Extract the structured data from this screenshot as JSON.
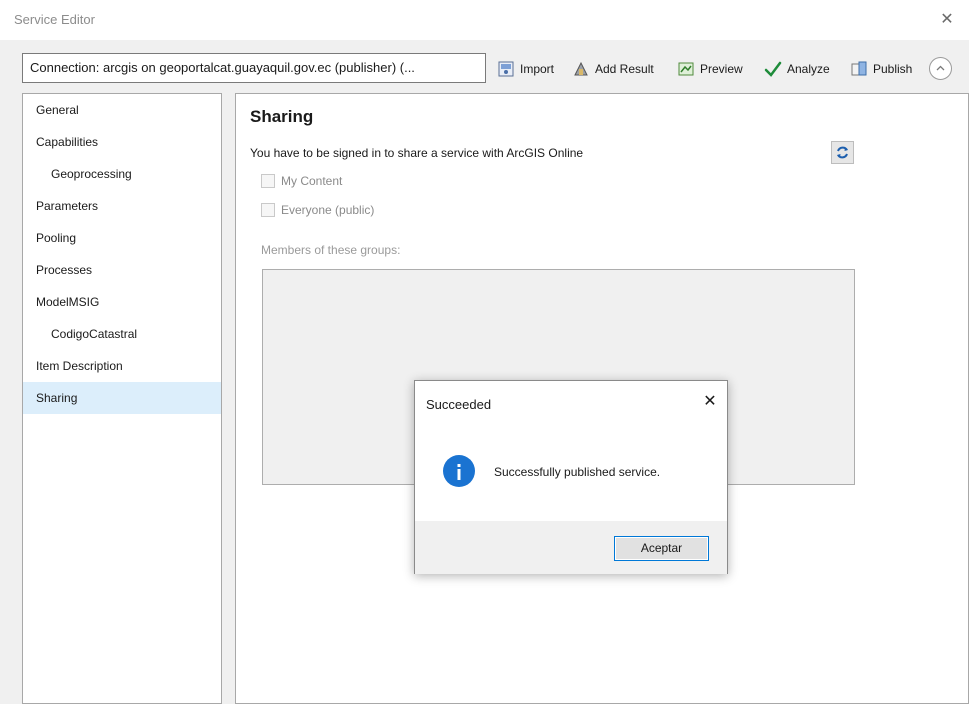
{
  "window": {
    "title": "Service Editor",
    "close_glyph": "✕"
  },
  "toolbar": {
    "connection_text": "Connection: arcgis on geoportalcat.guayaquil.gov.ec (publisher) (...",
    "import_label": "Import",
    "add_result_label": "Add Result",
    "preview_label": "Preview",
    "analyze_label": "Analyze",
    "publish_label": "Publish"
  },
  "sidebar": {
    "items": [
      {
        "label": "General"
      },
      {
        "label": "Capabilities"
      },
      {
        "label": "Geoprocessing"
      },
      {
        "label": "Parameters"
      },
      {
        "label": "Pooling"
      },
      {
        "label": "Processes"
      },
      {
        "label": "ModelMSIG"
      },
      {
        "label": "CodigoCatastral"
      },
      {
        "label": "Item Description"
      },
      {
        "label": "Sharing"
      }
    ],
    "selected": "Sharing"
  },
  "sharing": {
    "heading": "Sharing",
    "signin_text": "You have to be signed in to share a service with ArcGIS Online",
    "my_content_label": "My Content",
    "everyone_label": "Everyone (public)",
    "groups_label": "Members of these groups:"
  },
  "dialog": {
    "title": "Succeeded",
    "message": "Successfully published service.",
    "ok_label": "Aceptar",
    "close_glyph": "✕"
  },
  "colors": {
    "selected_nav_bg": "#dceefb",
    "info_icon": "#1a73d1",
    "analyze_check": "#1e8c3a",
    "dialog_button_border": "#0078d7"
  },
  "icons": [
    "close-icon",
    "import-icon",
    "add-result-icon",
    "preview-icon",
    "analyze-check-icon",
    "publish-icon",
    "chevron-up-icon",
    "refresh-icon",
    "info-icon"
  ]
}
